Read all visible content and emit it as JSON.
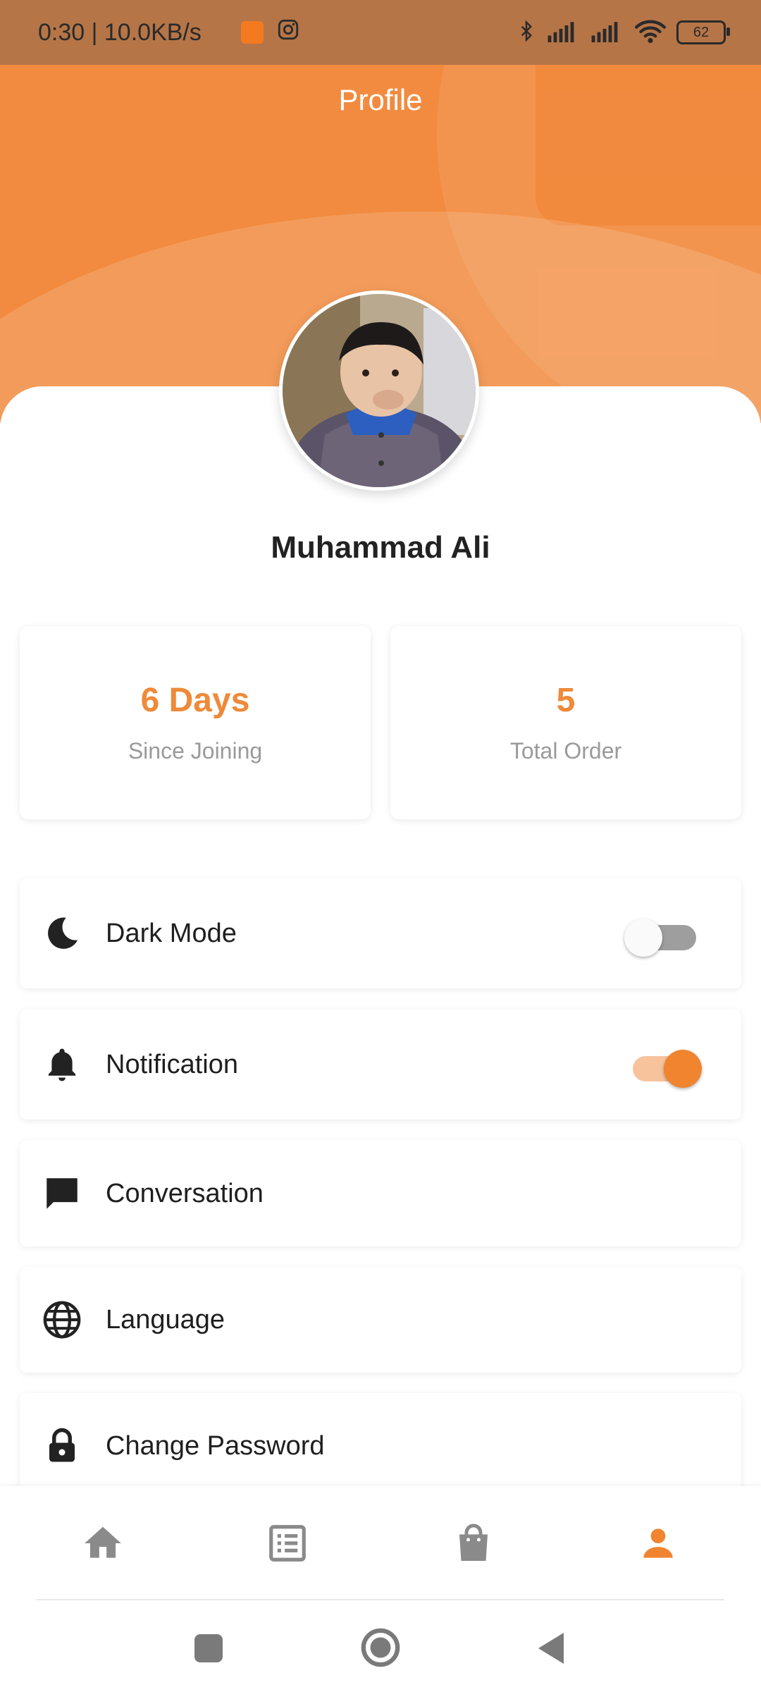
{
  "status_bar": {
    "time_speed": "0:30 | 10.0KB/s",
    "battery": "62"
  },
  "header": {
    "title": "Profile"
  },
  "profile": {
    "name": "Muhammad Ali"
  },
  "stats": [
    {
      "value": "6 Days",
      "label": "Since Joining"
    },
    {
      "value": "5",
      "label": "Total Order"
    }
  ],
  "settings": [
    {
      "label": "Dark Mode",
      "icon": "moon-icon",
      "toggle": false
    },
    {
      "label": "Notification",
      "icon": "bell-icon",
      "toggle": true
    },
    {
      "label": "Conversation",
      "icon": "chat-icon"
    },
    {
      "label": "Language",
      "icon": "globe-icon"
    },
    {
      "label": "Change Password",
      "icon": "lock-icon"
    }
  ],
  "bottom_nav": [
    {
      "icon": "home-icon",
      "active": false
    },
    {
      "icon": "orders-list-icon",
      "active": false
    },
    {
      "icon": "shopping-bag-icon",
      "active": false
    },
    {
      "icon": "profile-icon",
      "active": true
    }
  ],
  "colors": {
    "accent": "#ee8a3a",
    "header": "#f28b3f",
    "inactive_icon": "#8a8a8a"
  }
}
